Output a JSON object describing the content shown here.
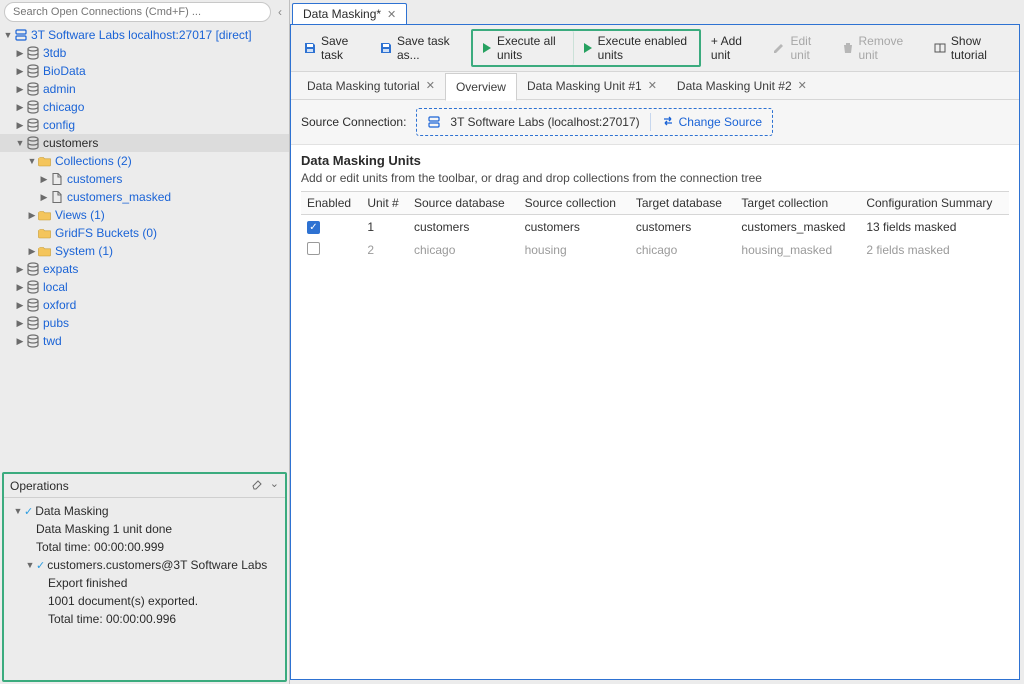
{
  "search": {
    "placeholder": "Search Open Connections (Cmd+F) ..."
  },
  "tree": {
    "root_label": "3T Software Labs localhost:27017 [direct]",
    "dbs": [
      {
        "label": "3tdb"
      },
      {
        "label": "BioData"
      },
      {
        "label": "admin"
      },
      {
        "label": "chicago"
      },
      {
        "label": "config"
      }
    ],
    "customers": {
      "label": "customers",
      "collections_label": "Collections (2)",
      "coll_a": "customers",
      "coll_b": "customers_masked",
      "views_label": "Views (1)",
      "gridfs_label": "GridFS Buckets (0)",
      "system_label": "System (1)"
    },
    "dbs_after": [
      {
        "label": "expats"
      },
      {
        "label": "local"
      },
      {
        "label": "oxford"
      },
      {
        "label": "pubs"
      },
      {
        "label": "twd"
      }
    ]
  },
  "ops": {
    "title": "Operations",
    "root": "Data Masking",
    "line1": "Data Masking 1 unit done",
    "line2": "Total time: 00:00:00.999",
    "child": "customers.customers@3T Software Labs",
    "child1": "Export finished",
    "child2": "1001 document(s) exported.",
    "child3": "Total time: 00:00:00.996"
  },
  "editor_tab": "Data Masking*",
  "toolbar": {
    "save": "Save task",
    "save_as": "Save task as...",
    "exec_all": "Execute all units",
    "exec_enabled": "Execute enabled units",
    "add_unit": "+ Add unit",
    "edit_unit": "Edit unit",
    "remove_unit": "Remove unit",
    "show_tutorial": "Show tutorial"
  },
  "subtabs": {
    "a": "Data Masking tutorial",
    "b": "Overview",
    "c": "Data Masking Unit #1",
    "d": "Data Masking Unit #2"
  },
  "source": {
    "label": "Source Connection:",
    "value": "3T Software Labs (localhost:27017)",
    "change": "Change Source"
  },
  "units": {
    "title": "Data Masking Units",
    "hint": "Add or edit units from the toolbar, or drag and drop collections from the connection tree",
    "headers": {
      "enabled": "Enabled",
      "unit": "Unit #",
      "src_db": "Source database",
      "src_coll": "Source collection",
      "tgt_db": "Target database",
      "tgt_coll": "Target collection",
      "summary": "Configuration Summary"
    },
    "rows": [
      {
        "enabled": true,
        "unit": "1",
        "src_db": "customers",
        "src_coll": "customers",
        "tgt_db": "customers",
        "tgt_coll": "customers_masked",
        "summary": "13 fields masked"
      },
      {
        "enabled": false,
        "unit": "2",
        "src_db": "chicago",
        "src_coll": "housing",
        "tgt_db": "chicago",
        "tgt_coll": "housing_masked",
        "summary": "2 fields masked"
      }
    ]
  }
}
